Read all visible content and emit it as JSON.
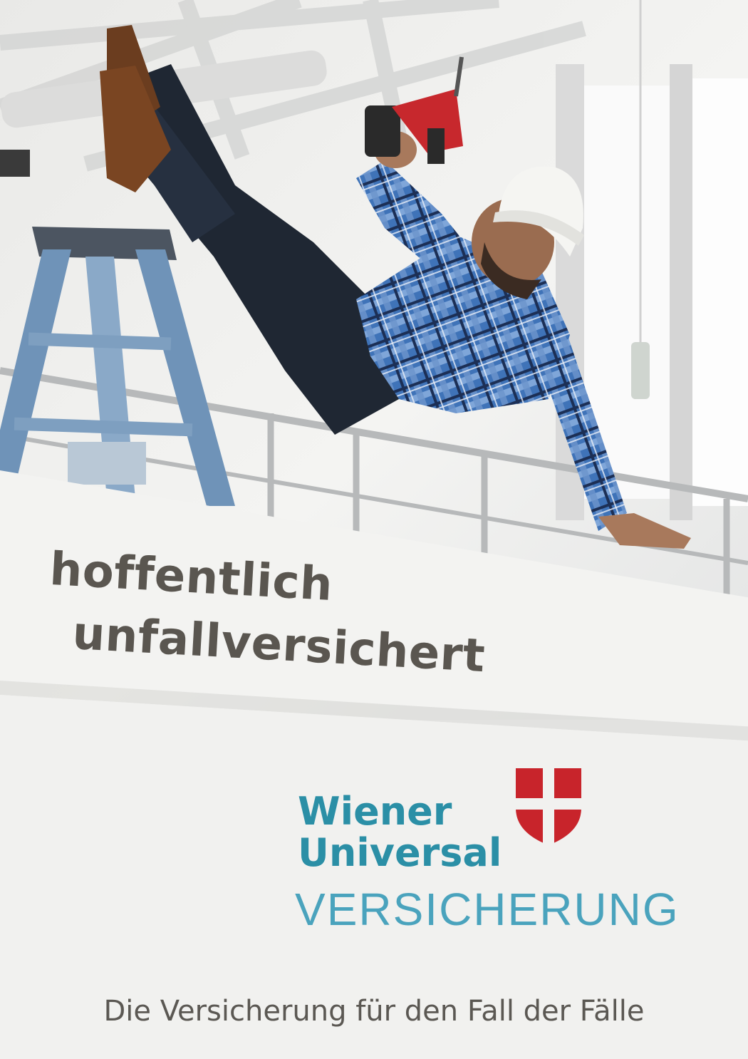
{
  "headline": {
    "line1": "hoffentlich",
    "line2": "unfallversichert"
  },
  "brand": {
    "name_line1": "Wiener",
    "name_line2": "Universal",
    "name_line3": "VERSICHERUNG",
    "name_color": "#2b8fa6",
    "sub_color": "#4aa3bd",
    "shield_color": "#c8242b",
    "logo_icon": "vienna-coat-of-arms-shield"
  },
  "tagline": "Die Versicherung für den Fall der Fälle",
  "colors": {
    "headline_text": "#5a5650",
    "background": "#f1f1ef",
    "ladder": "#6f93b8",
    "shirt_plaid": "#3f73b8"
  },
  "illustration": {
    "subject": "worker-in-hard-hat-falling-off-ladder-holding-drill"
  }
}
